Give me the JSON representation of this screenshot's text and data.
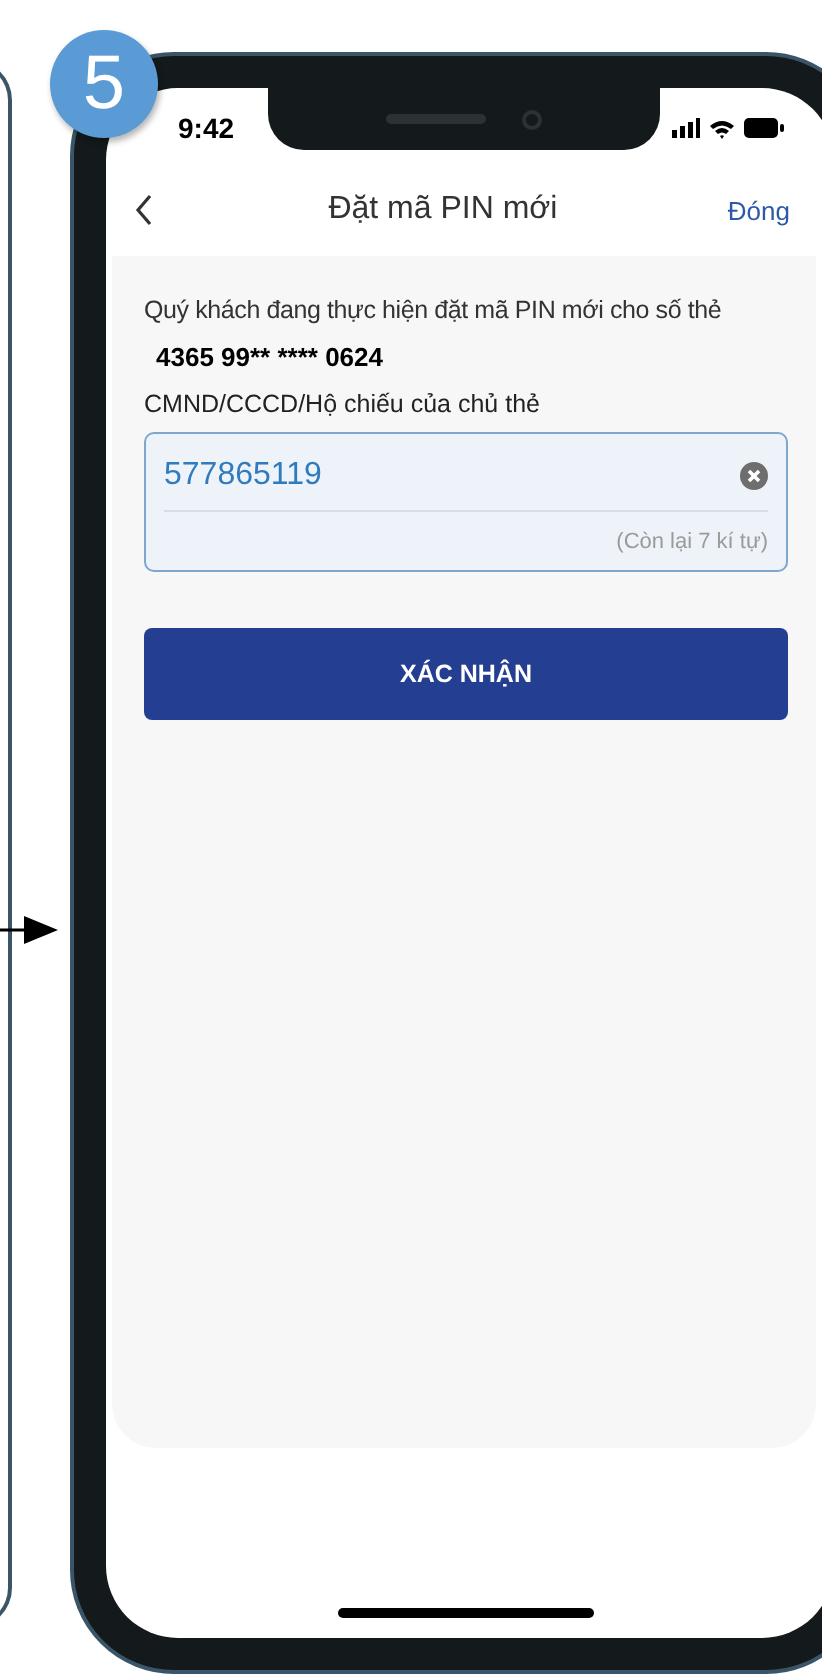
{
  "step_badge": "5",
  "status_bar": {
    "time": "9:42"
  },
  "nav_bar": {
    "title": "Đặt mã PIN mới",
    "close": "Đóng"
  },
  "form": {
    "notice": "Quý khách đang thực hiện đặt mã PIN mới cho số thẻ",
    "card_number": "4365 99** **** 0624",
    "field_label": "CMND/CCCD/Hộ chiếu của chủ thẻ",
    "field_value": "577865119",
    "counter": "(Còn lại 7 kí tự)",
    "submit": "XÁC NHẬN"
  }
}
